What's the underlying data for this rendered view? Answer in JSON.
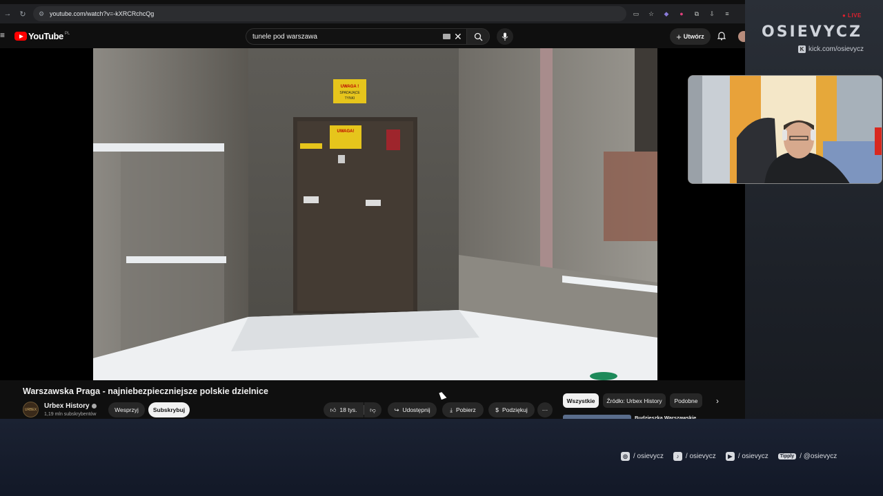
{
  "browser": {
    "url": "youtube.com/watch?v=-kXRCRchcQg"
  },
  "youtube": {
    "logo_text": "YouTube",
    "logo_region": "PL",
    "search_value": "tunele pod warszawa",
    "create_label": "Utwórz"
  },
  "video": {
    "sign_top": "UWAGA !\nSPADAJĄCE\nTYNKI",
    "sign_door": "UWAGA!",
    "title": "Warszawska Praga - najniebezpieczniejsze polskie dzielnice",
    "channel_name": "Urbex History",
    "channel_subs": "1,19 mln subskrybentów",
    "channel_avatar_text": "URBEX"
  },
  "actions": {
    "join": "Wesprzyj",
    "subscribe": "Subskrybuj",
    "likes": "18 tys.",
    "share": "Udostępnij",
    "download": "Pobierz",
    "thanks": "Podziękuj"
  },
  "chips": {
    "all": "Wszystkie",
    "from": "Źródło: Urbex History",
    "related": "Podobne"
  },
  "recommendation": {
    "title": "Budzieszka Warszawskie"
  },
  "overlay": {
    "live": "● LIVE",
    "streamer": "OSIEVYCZ",
    "kick": "kick.com/osievycz",
    "socials": [
      {
        "icon": "instagram-icon",
        "label": "/ osievycz"
      },
      {
        "icon": "tiktok-icon",
        "label": "/ osievycz"
      },
      {
        "icon": "youtube-icon",
        "label": "/ osievycz"
      },
      {
        "icon": "tipply-icon",
        "badge": "Tipply",
        "label": "/ @osievycz"
      }
    ]
  }
}
